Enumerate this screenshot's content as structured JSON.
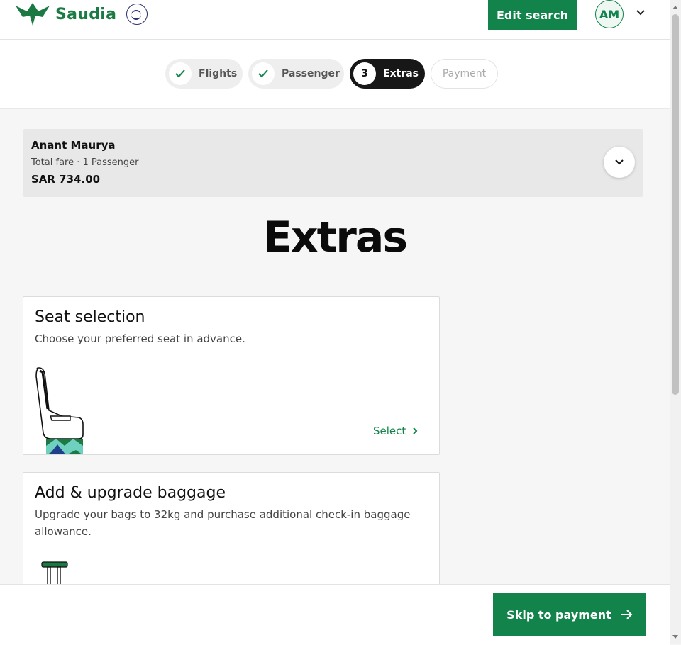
{
  "header": {
    "brand": "Saudia",
    "edit_search": "Edit search",
    "avatar_initials": "AM"
  },
  "steps": [
    {
      "label": "Flights",
      "state": "done"
    },
    {
      "label": "Passenger",
      "state": "done"
    },
    {
      "label": "Extras",
      "state": "active",
      "number": "3"
    },
    {
      "label": "Payment",
      "state": "todo"
    }
  ],
  "fare": {
    "name": "Anant Maurya",
    "subtitle": "Total fare · 1 Passenger",
    "price": "SAR 734.00"
  },
  "page_title": "Extras",
  "cards": {
    "seat": {
      "title": "Seat selection",
      "description": "Choose your preferred seat in advance.",
      "action": "Select"
    },
    "baggage": {
      "title": "Add & upgrade baggage",
      "description": "Upgrade your bags to 32kg and purchase additional check-in baggage allowance."
    }
  },
  "footer": {
    "skip": "Skip to payment"
  },
  "colors": {
    "brand_green": "#12834a",
    "active_step": "#171717"
  },
  "icons": [
    "saudia-logo-icon",
    "skyteam-logo-icon",
    "chevron-down-icon",
    "check-icon",
    "chevron-right-icon",
    "arrow-right-icon",
    "seat-illustration",
    "baggage-illustration"
  ]
}
